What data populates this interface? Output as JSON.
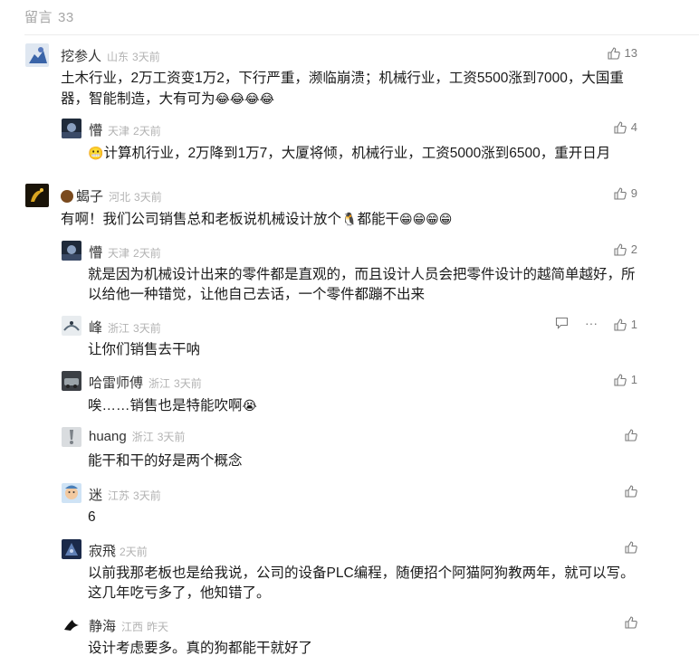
{
  "header": {
    "title": "留言",
    "count": "33"
  },
  "comments": [
    {
      "name": "挖参人",
      "location": "山东",
      "time": "3天前",
      "likes": "13",
      "text": "土木行业，2万工资变1万2，下行严重，濒临崩溃；机械行业，工资5500涨到7000，大国重器，智能制造，大有可为",
      "emoji_after": "😂😂😂😂"
    },
    {
      "name": "懵",
      "location": "天津",
      "time": "2天前",
      "likes": "4",
      "text": "计算机行业，2万降到1万7，大厦将倾，机械行业，工资5000涨到6500，重开日月",
      "emoji_before": "😬"
    },
    {
      "name": "蝎子",
      "location": "河北",
      "time": "3天前",
      "likes": "9",
      "text_a": "有啊！我们公司销售总和老板说机械设计放个",
      "text_b": "都能干",
      "emoji_mid": "🐧",
      "emoji_after": "😁😁😁😁"
    },
    {
      "name": "懵",
      "location": "天津",
      "time": "2天前",
      "likes": "2",
      "text": "就是因为机械设计出来的零件都是直观的，而且设计人员会把零件设计的越简单越好，所以给他一种错觉，让他自己去话，一个零件都蹦不出来"
    },
    {
      "name": "峰",
      "location": "浙江",
      "time": "3天前",
      "likes": "1",
      "text": "让你们销售去干呐",
      "more": "···"
    },
    {
      "name": "哈雷师傅",
      "location": "浙江",
      "time": "3天前",
      "likes": "1",
      "text": "唉……销售也是特能吹啊",
      "emoji_after": "😭"
    },
    {
      "name": "huang",
      "location": "浙江",
      "time": "3天前",
      "likes": "",
      "text": "能干和干的好是两个概念"
    },
    {
      "name": "迷",
      "location": "江苏",
      "time": "3天前",
      "likes": "",
      "text": "6"
    },
    {
      "name": "寂飛",
      "location": "",
      "time": "2天前",
      "likes": "",
      "text": "以前我那老板也是给我说，公司的设备PLC编程，随便招个阿猫阿狗教两年，就可以写。这几年吃亏多了，他知错了。"
    },
    {
      "name": "静海",
      "location": "江西",
      "time": "昨天",
      "likes": "",
      "text": "设计考虑要多。真的狗都能干就好了"
    }
  ]
}
